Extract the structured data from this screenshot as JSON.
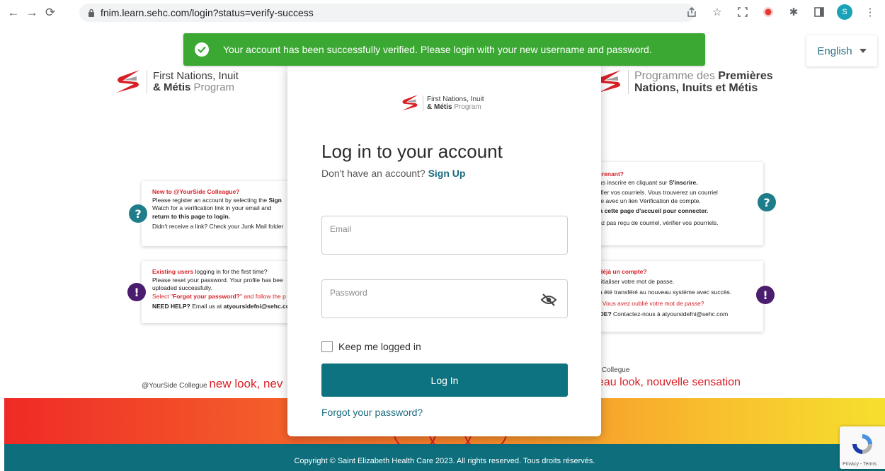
{
  "browser": {
    "url": "fnim.learn.sehc.com/login?status=verify-success",
    "profile_initial": "S"
  },
  "alert": {
    "message": "Your account has been successfully verified. Please login with your new username and password."
  },
  "language": {
    "selected": "English"
  },
  "logo_en": {
    "line1": "First Nations, Inuit",
    "line2_bold": "& Métis",
    "line2_soft": "Program"
  },
  "logo_fr": {
    "line1_soft": "Programme des",
    "line1_bold": "Premières",
    "line2": "Nations, Inuits et Métis"
  },
  "modal": {
    "title": "Log in to your account",
    "signup_prompt": "Don't have an account?",
    "signup_link": "Sign Up",
    "email_label": "Email",
    "email_value": "",
    "password_label": "Password",
    "password_value": "",
    "remember_label": "Keep me logged in",
    "login_label": "Log In",
    "forgot_label": "Forgot your password?"
  },
  "cards": {
    "left1": {
      "heading": "New to @YourSide Colleague?",
      "l1": "Please register an account by selecting the",
      "l1_bold": "Sign",
      "l2": "Watch for a verification link in your email and",
      "l3_bold": "return to this page to login.",
      "l4": "Didn't receive a link? Check your Junk Mail folder"
    },
    "left2": {
      "heading_red": "Existing users",
      "heading_rest": "logging in for the first time?",
      "l1": "Please reset your password. Your profile has bee",
      "l2": "uploaded successfully.",
      "l3_red": "Select \"",
      "l3_bold": "Forgot your password?",
      "l3_red2": "\" and follow the p",
      "l4_bold": "NEED HELP?",
      "l4": "Email us at",
      "l4_email": "atyoursidefni@sehc.com"
    },
    "right1": {
      "heading": "l apprenant?",
      "l1": "z-vous inscrire en cliquant sur",
      "l1_bold": "S'inscrire.",
      "l2": ", vérifier vos courriels. Vous trouverez un courriel",
      "l3": "venue avec un lien Vérification de compte.",
      "l4_bold": "nez à cette page d'accueil pour connecter.",
      "l5": "n'avez pas reçu de courriel, vérifier vos pourriels."
    },
    "right2": {
      "heading": "vez déjà un compte?",
      "l1": ": réinitialiser votre mot de passe.",
      "l2": "rofil a été transféré au nouveau système avec succès.",
      "l3": "nnez Vous avez oublié votre mot de passe?",
      "l4_bold": "D'AIDE?",
      "l4": "Contactez-nous à atyoursidefni@sehc.com"
    }
  },
  "slogan_en": {
    "small": "@YourSide Collegue",
    "big": "new look, nev"
  },
  "slogan_fr": {
    "small": "de Collegue",
    "big": "veau look, nouvelle sensation"
  },
  "footer": {
    "copyright": "Copyright © Saint Elizabeth Health Care 2023. All rights reserved. Tous droits réservés."
  },
  "recaptcha": {
    "text": "Privacy - Terms"
  },
  "colors": {
    "teal": "#0e7380",
    "success": "#3aa832",
    "red": "#d81f26",
    "purple": "#4b1d6e"
  }
}
